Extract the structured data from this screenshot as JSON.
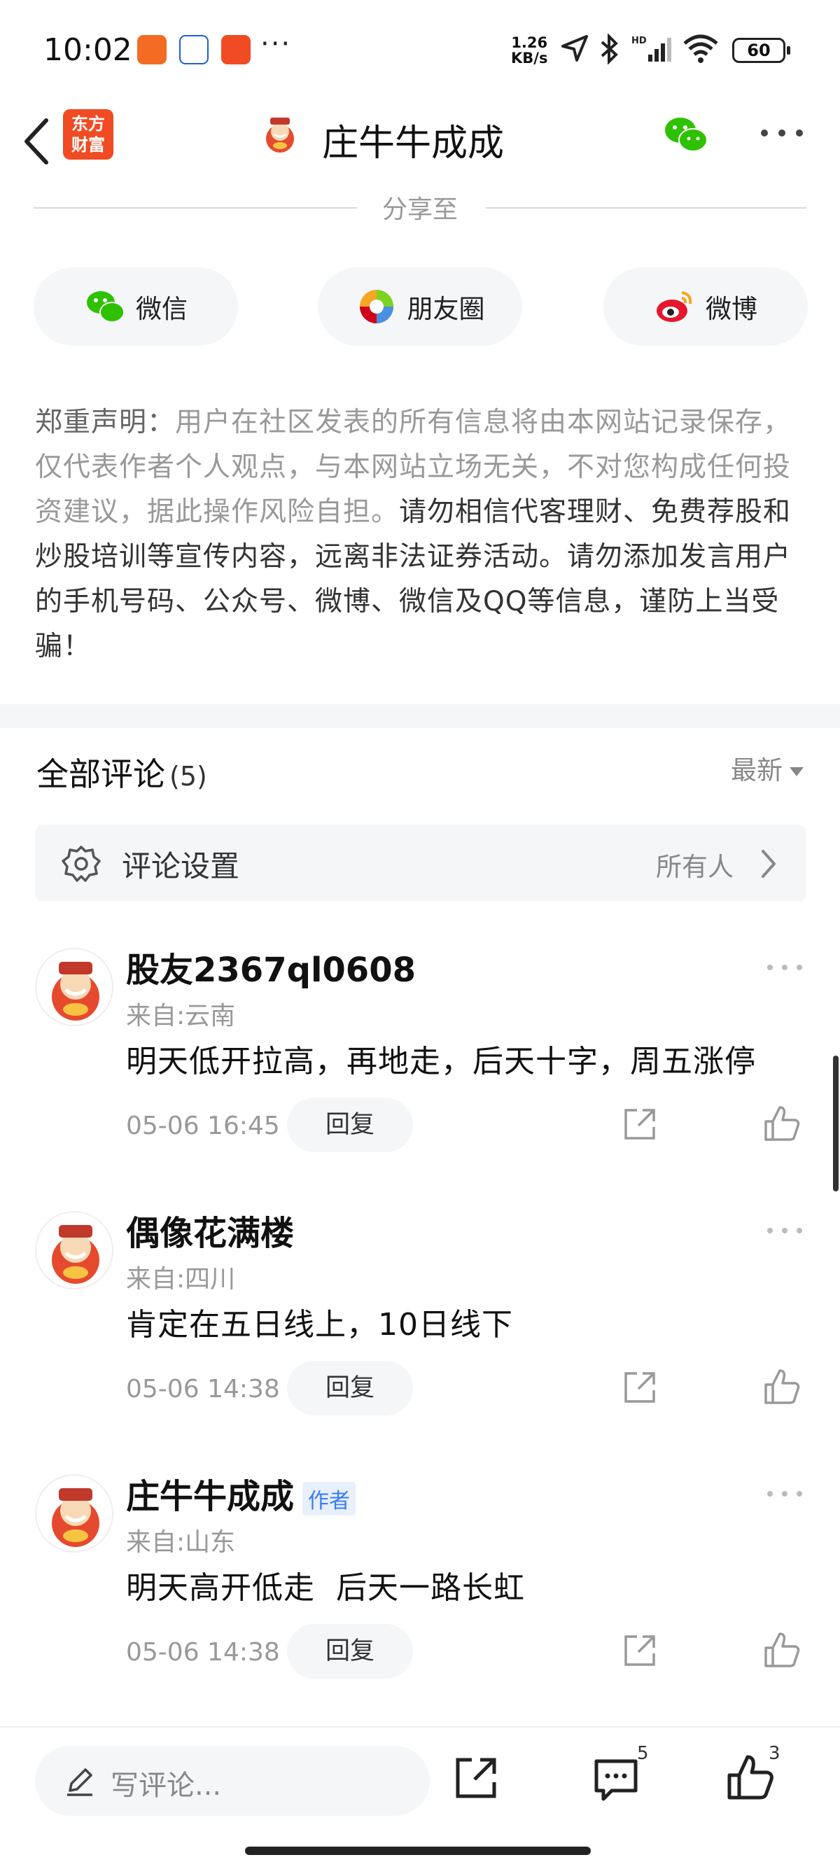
{
  "status_bar": {
    "time": "10:02",
    "network_speed_top": "1.26",
    "network_speed_unit": "KB/s",
    "battery": "60",
    "dots": "···"
  },
  "header": {
    "logo_line1": "东方",
    "logo_line2": "财富",
    "title": "庄牛牛成成"
  },
  "share": {
    "label": "分享至",
    "buttons": [
      {
        "label": "微信",
        "icon": "wechat-icon"
      },
      {
        "label": "朋友圈",
        "icon": "moments-icon"
      },
      {
        "label": "微博",
        "icon": "weibo-icon"
      }
    ]
  },
  "disclaimer": {
    "head": "郑重声明：",
    "normal": "用户在社区发表的所有信息将由本网站记录保存，仅代表作者个人观点，与本网站立场无关，不对您构成任何投资建议，据此操作风险自担。",
    "strong": "请勿相信代客理财、免费荐股和炒股培训等宣传内容，远离非法证券活动。请勿添加发言用户的手机号码、公众号、微博、微信及QQ等信息，谨防上当受骗！"
  },
  "comments_header": {
    "title": "全部评论",
    "count": "(5)",
    "sort": "最新"
  },
  "settings": {
    "label": "评论设置",
    "value": "所有人"
  },
  "comments": [
    {
      "name": "股友2367ql0608",
      "location": "来自:云南",
      "text": "明天低开拉高，再地走，后天十字，周五涨停",
      "time": "05-06 16:45",
      "reply": "回复",
      "is_author": false
    },
    {
      "name": "偶像花满楼",
      "location": "来自:四川",
      "text": "肯定在五日线上，10日线下",
      "time": "05-06 14:38",
      "reply": "回复",
      "is_author": false
    },
    {
      "name": "庄牛牛成成",
      "author_badge": "作者",
      "location": "来自:山东",
      "text": "明天高开低走  后天一路长虹",
      "time": "05-06 14:38",
      "reply": "回复",
      "is_author": true
    }
  ],
  "bottom_bar": {
    "write_placeholder": "写评论...",
    "comment_count": "5",
    "like_count": "3"
  },
  "colors": {
    "logo_red": "#f04b23",
    "wechat_green": "#2dc100",
    "author_blue": "#3a7cf4",
    "panel_gray": "#f5f6f8"
  }
}
